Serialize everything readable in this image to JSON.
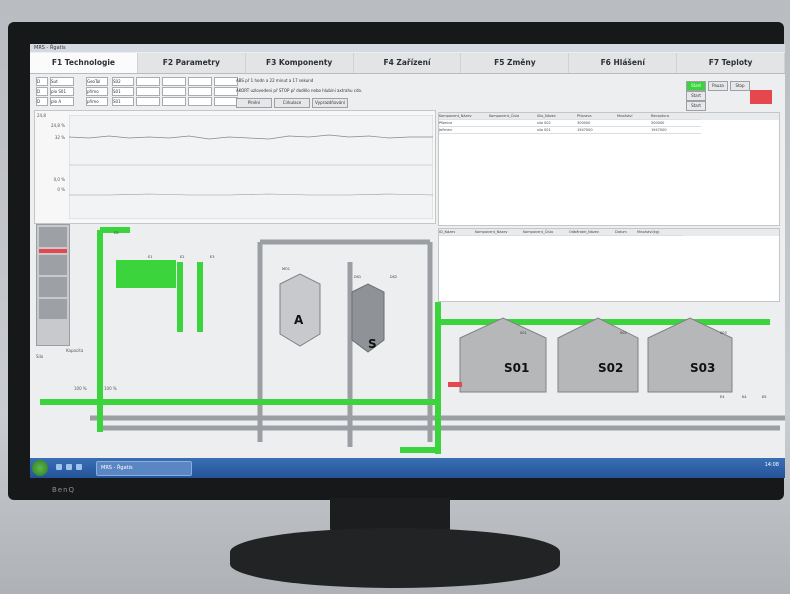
{
  "monitor": {
    "brand": "BenQ"
  },
  "window": {
    "title": "MRS - Řgatis"
  },
  "tabs": [
    {
      "label": "F1 Technologie"
    },
    {
      "label": "F2 Parametry"
    },
    {
      "label": "F3 Komponenty"
    },
    {
      "label": "F4 Zařízení"
    },
    {
      "label": "F5 Změny"
    },
    {
      "label": "F6 Hlášení"
    },
    {
      "label": "F7 Teploty"
    }
  ],
  "controls": {
    "rows": [
      {
        "col1": "D",
        "col2": "Sut",
        "col3": "GeoTal",
        "col4": "S02"
      },
      {
        "col1": "D",
        "col2": "plo S01",
        "col3": "přímo",
        "col4": "S01"
      },
      {
        "col1": "D",
        "col2": "plo A",
        "col3": "přímo",
        "col4": "S01"
      }
    ],
    "messages": [
      "ABS př 1 hodn a 22 minut a 17 sekund",
      "AKORT uzlovedeni př STOP př dodělo nebo hlubini axtrahu cdo."
    ],
    "buttons": [
      "Plnění",
      "Cirkulace",
      "Vyprazdňování"
    ],
    "right_buttons": [
      "Start",
      "Start",
      "Start"
    ],
    "right_labels": [
      "Pauza",
      "Stop"
    ]
  },
  "trend": {
    "values": [
      "24,8",
      "24,8 %",
      "32 %",
      "0,0 %",
      "0 %"
    ]
  },
  "components_table": {
    "headers": [
      "Komponent_Název",
      "Komponent_Číslo",
      "Silo_Název",
      "Příprava",
      "Množství",
      "Receptura"
    ],
    "rows": [
      [
        "Pšenice",
        "",
        "silo S02",
        "300000",
        "",
        "300000"
      ],
      [
        "Ječmen",
        "",
        "silo S01",
        "1947000",
        "",
        "1947000"
      ]
    ]
  },
  "events_table": {
    "headers": [
      "ID_Název",
      "Komponent_Název",
      "Komponent_Číslo",
      "Odběratel_Název",
      "Datum",
      "Množství(kg)"
    ]
  },
  "process": {
    "small_silos": [
      "A",
      "S"
    ],
    "big_silos": [
      "S01",
      "S02",
      "S03"
    ],
    "labels": [
      "D1",
      "E1",
      "E2",
      "E3",
      "MO1",
      "DS1",
      "DS2",
      "S03",
      "S01",
      "S02",
      "E4",
      "K4",
      "K5"
    ]
  },
  "left_panel": {
    "labels": [
      "Kapacita",
      "100 %",
      "100 %",
      "Silo"
    ]
  },
  "taskbar": {
    "task": "MRS - Řgatis",
    "clock": "14:08"
  },
  "colors": {
    "active": "#3cd43c",
    "idle": "#b6b7b9",
    "alarm": "#e5474f"
  }
}
